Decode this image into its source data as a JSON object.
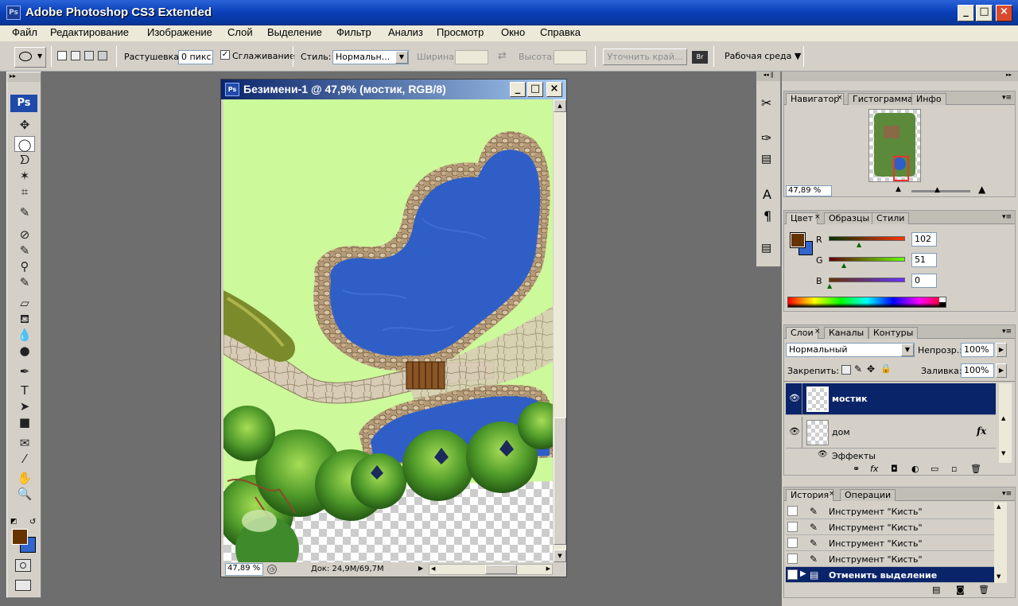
{
  "window": {
    "title": "Adobe Photoshop CS3 Extended",
    "app_icon": "Ps",
    "minimize": "_",
    "maximize": "□",
    "close": "×"
  },
  "menu": [
    "Файл",
    "Редактирование",
    "Изображение",
    "Слой",
    "Выделение",
    "Фильтр",
    "Анализ",
    "Просмотр",
    "Окно",
    "Справка"
  ],
  "options": {
    "feather_label": "Растушевка:",
    "feather_value": "0 пикс.",
    "antialias_label": "Сглаживание",
    "antialias_checked": true,
    "style_label": "Стиль:",
    "style_value": "Нормальн...",
    "width_label": "Ширина:",
    "height_label": "Высота:",
    "refine_edge": "Уточнить край...",
    "workspace": "Рабочая среда ▼"
  },
  "toolbox": {
    "logo": "Ps",
    "tools": [
      "move-tool",
      "marquee-tool",
      "lasso-tool",
      "magic-wand-tool",
      "crop-tool",
      "slice-tool",
      "healing-brush-tool",
      "brush-tool",
      "clone-stamp-tool",
      "history-brush-tool",
      "eraser-tool",
      "paint-bucket-tool",
      "blur-tool",
      "dodge-tool",
      "pen-tool",
      "type-tool",
      "path-selection-tool",
      "rectangle-tool",
      "notes-tool",
      "eyedropper-tool",
      "hand-tool",
      "zoom-tool"
    ],
    "tool_glyphs": [
      "✥",
      "◯",
      "ᗤ",
      "✶",
      "⌗",
      "✎",
      "⊘",
      "✎",
      "⚲",
      "✎",
      "▱",
      "⛾",
      "💧",
      "●",
      "✒",
      "T",
      "➤",
      "■",
      "✉",
      "⁄",
      "✋",
      "🔍"
    ],
    "fg_color": "#663300",
    "bg_color": "#3366cc"
  },
  "document": {
    "title": "Безимени-1 @ 47,9% (мостик, RGB/8)",
    "zoom": "47,89 %",
    "doc_info": "Док: 24,9M/69,7M"
  },
  "navigator": {
    "tabs": [
      "Навигатор",
      "Гистограмма",
      "Инфо"
    ],
    "zoom": "47,89 %",
    "zoom_level": 0.45
  },
  "color_panel": {
    "tabs": [
      "Цвет",
      "Образцы",
      "Стили"
    ],
    "channels": [
      {
        "label": "R",
        "value": "102"
      },
      {
        "label": "G",
        "value": "51"
      },
      {
        "label": "B",
        "value": "0"
      }
    ],
    "fg": "#663300",
    "bg": "#3366cc"
  },
  "layers": {
    "tabs": [
      "Слои",
      "Каналы",
      "Контуры"
    ],
    "blend_mode": "Нормальный",
    "opacity_label": "Непрозр.:",
    "opacity": "100%",
    "lock_label": "Закрепить:",
    "fill_label": "Заливка:",
    "fill": "100%",
    "items": [
      {
        "name": "мостик",
        "selected": true
      },
      {
        "name": "дом",
        "fx": "fx",
        "effects": "Эффекты"
      }
    ]
  },
  "history": {
    "tabs": [
      "История",
      "Операции"
    ],
    "items": [
      "Инструмент \"Кисть\"",
      "Инструмент \"Кисть\"",
      "Инструмент \"Кисть\"",
      "Инструмент \"Кисть\"",
      "Отменить выделение"
    ]
  }
}
